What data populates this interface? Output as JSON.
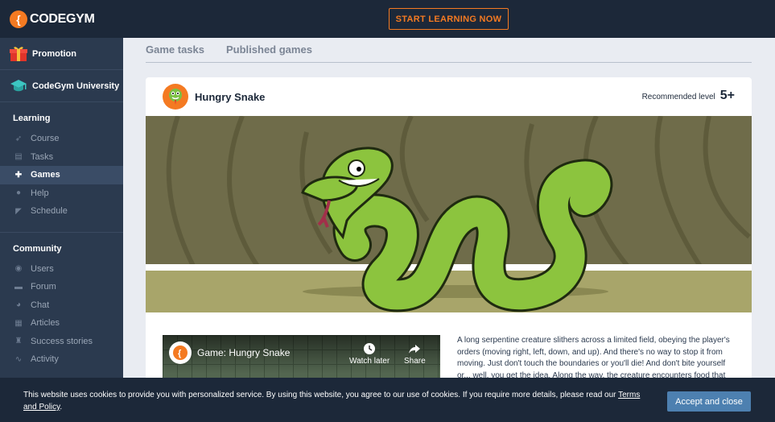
{
  "brand": {
    "name": "CODEGYM"
  },
  "topbar": {
    "cta_label": "START LEARNING NOW"
  },
  "sidebar": {
    "promo": [
      {
        "label": "Promotion",
        "icon": "gift-icon"
      },
      {
        "label": "CodeGym University",
        "icon": "graduation-cap-icon"
      }
    ],
    "learning_title": "Learning",
    "learning": [
      {
        "label": "Course",
        "icon": "rocket-icon"
      },
      {
        "label": "Tasks",
        "icon": "tasks-icon"
      },
      {
        "label": "Games",
        "icon": "gamepad-icon",
        "active": true
      },
      {
        "label": "Help",
        "icon": "help-icon"
      },
      {
        "label": "Schedule",
        "icon": "schedule-icon"
      }
    ],
    "community_title": "Community",
    "community": [
      {
        "label": "Users",
        "icon": "users-icon"
      },
      {
        "label": "Forum",
        "icon": "forum-icon"
      },
      {
        "label": "Chat",
        "icon": "chat-icon"
      },
      {
        "label": "Articles",
        "icon": "articles-icon"
      },
      {
        "label": "Success stories",
        "icon": "success-stories-icon"
      },
      {
        "label": "Activity",
        "icon": "activity-icon"
      }
    ]
  },
  "tabs": [
    {
      "label": "Game tasks"
    },
    {
      "label": "Published games"
    }
  ],
  "game": {
    "title": "Hungry Snake",
    "recommended_label": "Recommended level",
    "recommended_value": "5+",
    "video": {
      "title": "Game: Hungry Snake",
      "watch_later": "Watch later",
      "share": "Share"
    },
    "description": "A long serpentine creature slithers across a limited field, obeying the player's orders (moving right, left, down, and up). And there's no way to stop it from moving. Just don't touch the boundaries or you'll die! And don't bite yourself or... well, you get the idea. Along the way, the creature encounters food that makes"
  },
  "cookie": {
    "text": "This website uses cookies to provide you with personalized service. By using this website, you agree to our use of cookies. If you require more details, please read our",
    "link": "Terms and Policy",
    "suffix": ".",
    "accept_label": "Accept and close"
  },
  "colors": {
    "accent": "#f47a22",
    "sidebar": "#2b3a4f",
    "topbar": "#1c2839",
    "accept": "#4d80b0"
  }
}
